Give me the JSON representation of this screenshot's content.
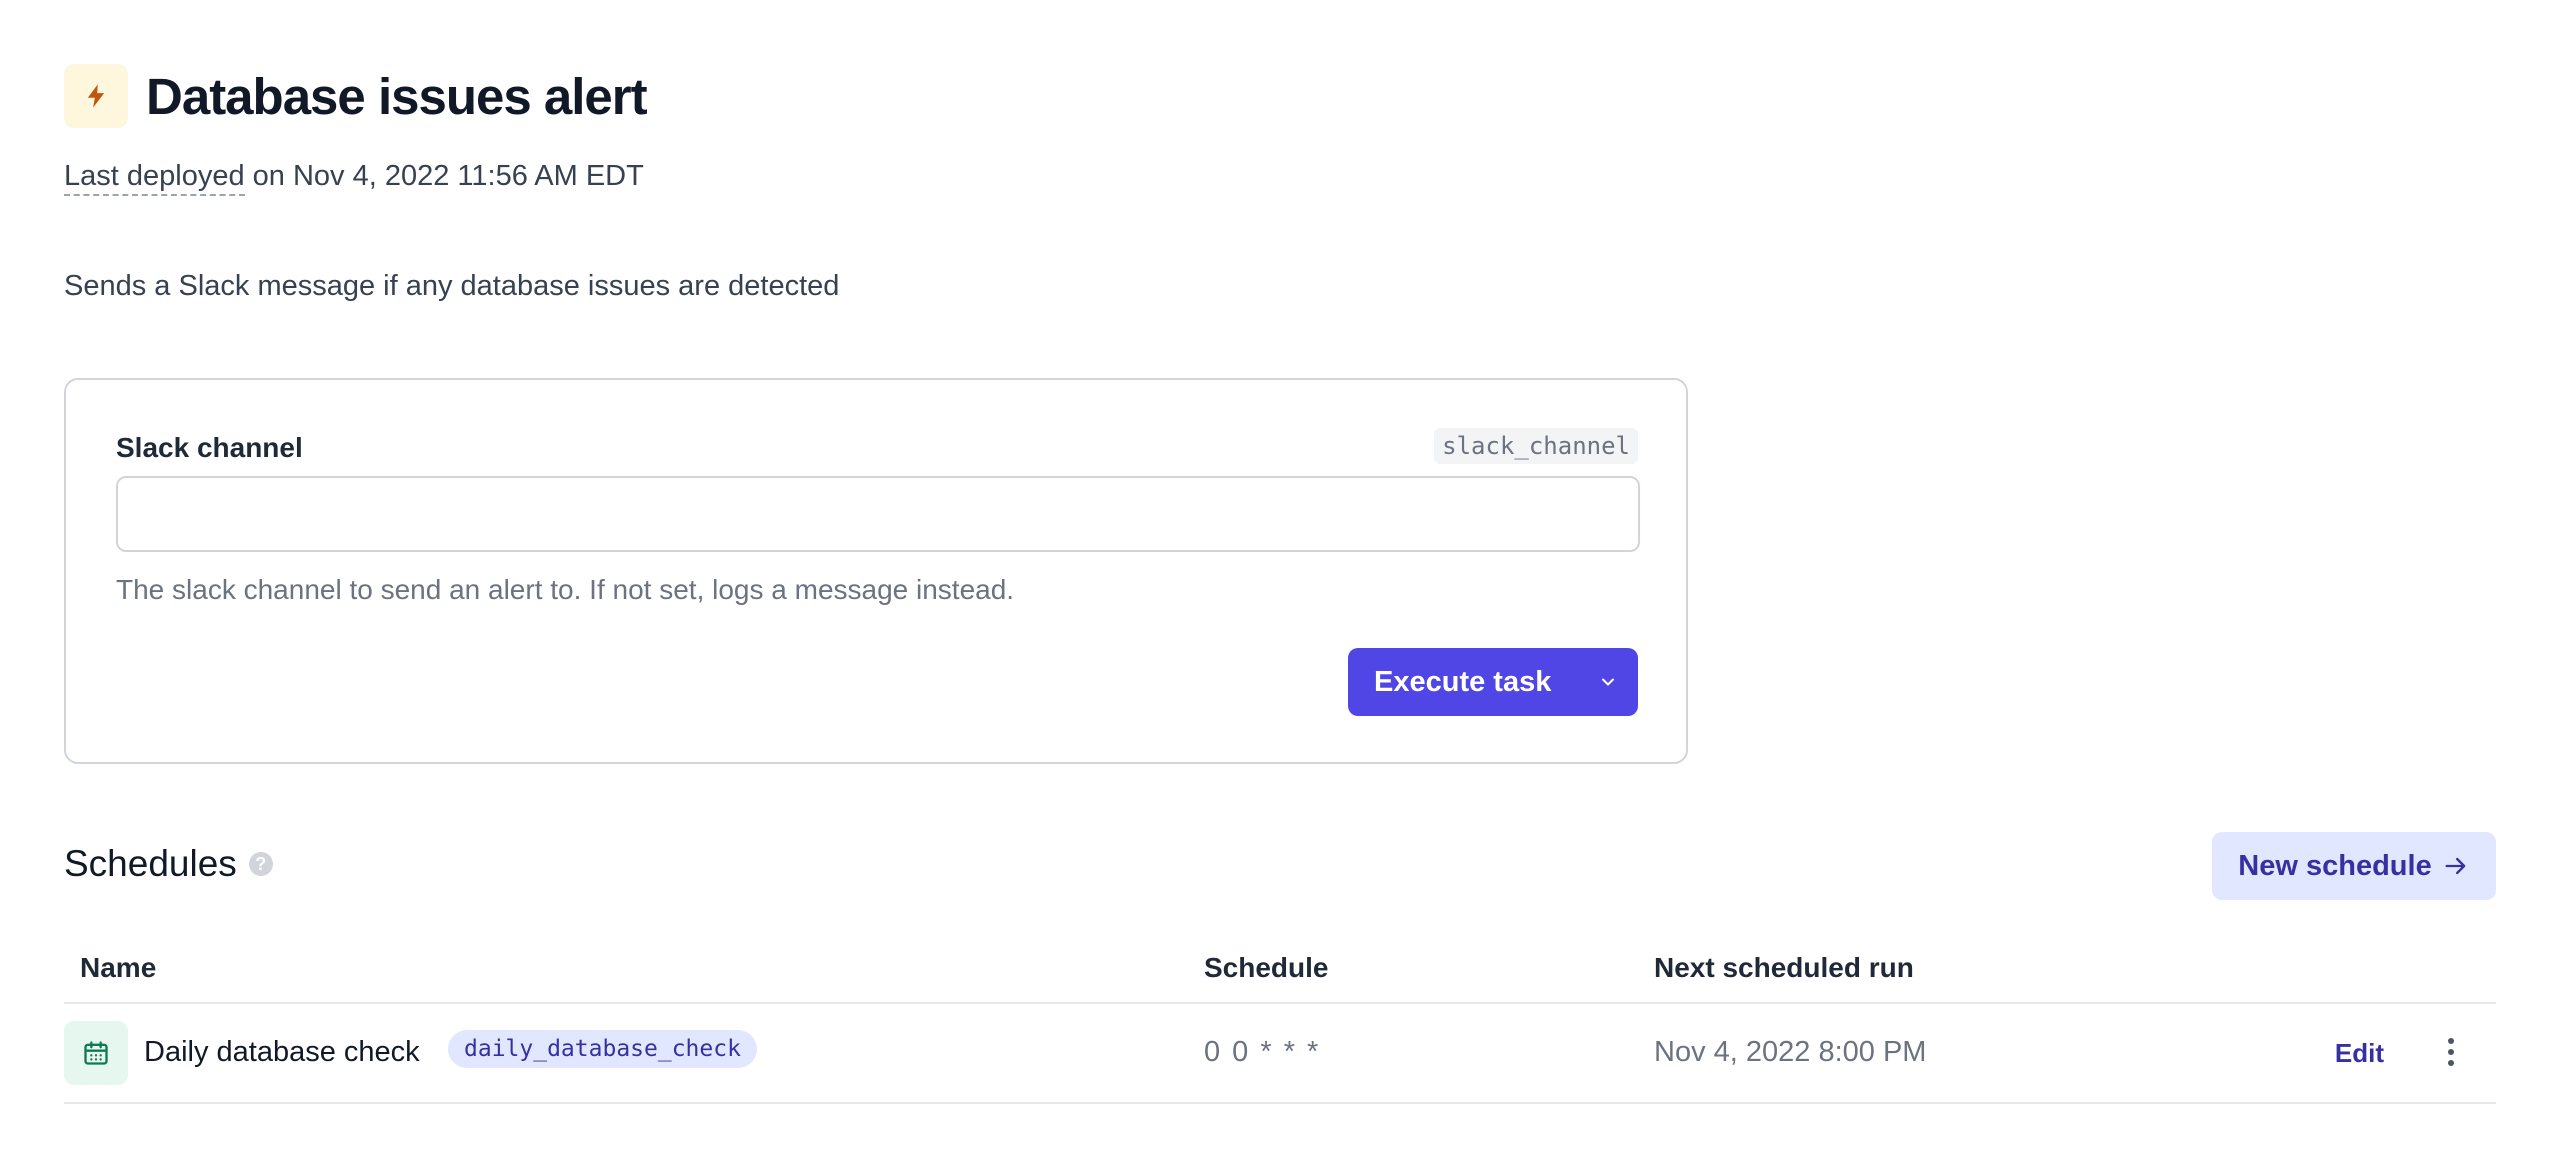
{
  "header": {
    "title": "Database issues alert",
    "deploy_prefix": "Last deployed",
    "deploy_suffix": " on Nov 4, 2022 11:56 AM EDT",
    "icon": "bolt-icon",
    "icon_color": "#c2560c",
    "icon_bg": "#fef6dd"
  },
  "description": "Sends a Slack message if any database issues are detected",
  "params": {
    "field_label": "Slack channel",
    "field_slug": "slack_channel",
    "field_value": "",
    "field_help": "The slack channel to send an alert to. If not set, logs a message instead.",
    "execute_label": "Execute task",
    "execute_color": "#4f46e5"
  },
  "schedules": {
    "title": "Schedules",
    "help_glyph": "?",
    "new_button_label": "New schedule",
    "columns": [
      "Name",
      "Schedule",
      "Next scheduled run"
    ],
    "rows": [
      {
        "name": "Daily database check",
        "slug": "daily_database_check",
        "cron": "0 0 * * *",
        "next_run": "Nov 4, 2022 8:00 PM",
        "edit_label": "Edit",
        "icon": "calendar-icon"
      }
    ]
  }
}
